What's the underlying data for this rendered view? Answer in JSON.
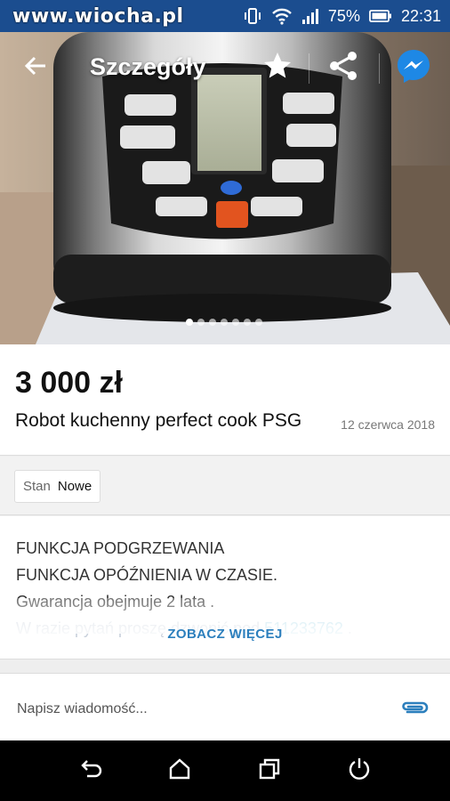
{
  "status_bar": {
    "watermark": "www.wiocha.pl",
    "battery_percent": "75%",
    "time": "22:31",
    "icons": [
      "vibrate-icon",
      "wifi-icon",
      "signal-icon",
      "battery-icon"
    ]
  },
  "header": {
    "title": "Szczegóły",
    "icons": [
      "back-arrow-icon",
      "star-icon",
      "share-icon",
      "messenger-icon"
    ]
  },
  "gallery": {
    "image_count": 7,
    "active_index": 0
  },
  "product": {
    "price": "3 000 zł",
    "title": "Robot kuchenny perfect cook PSG",
    "date": "12 czerwca 2018"
  },
  "params": {
    "label": "Stan",
    "value": "Nowe"
  },
  "description": {
    "lines": [
      " FUNKCJA PODGRZEWANIA",
      "FUNKCJA OPÓŹNIENIA W CZASIE.",
      "Gwarancja obejmuje 2 lata ."
    ],
    "faded_prefix": "W razie pytań proszę dzwonić pod ",
    "faded_phone": "511233762",
    "faded_suffix": " .",
    "see_more": "ZOBACZ WIĘCEJ"
  },
  "composer": {
    "placeholder": "Napisz wiadomość..."
  },
  "colors": {
    "status_bar": "#1b4d8f",
    "link": "#2c7fbd",
    "messenger": "#1e88e5"
  }
}
